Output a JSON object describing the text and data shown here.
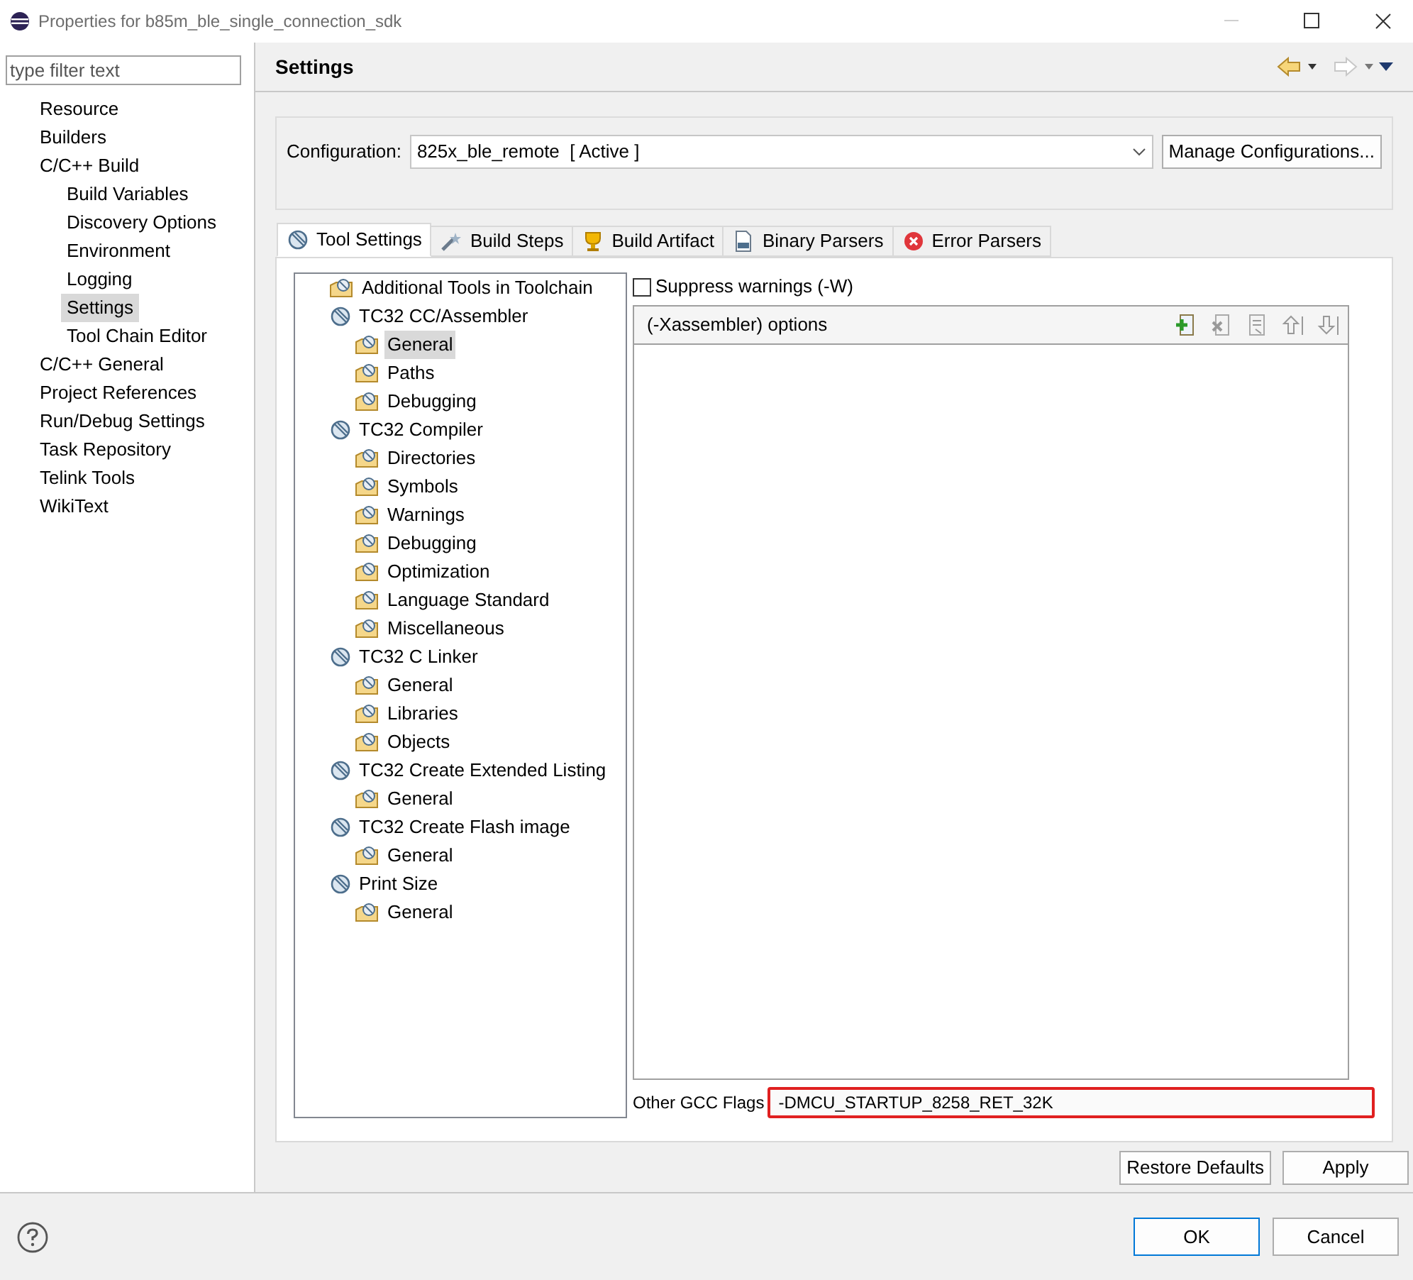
{
  "window": {
    "title": "Properties for b85m_ble_single_connection_sdk"
  },
  "filter": {
    "placeholder": "type filter text"
  },
  "sidebar": {
    "items": [
      {
        "label": "Resource",
        "selected": false
      },
      {
        "label": "Builders",
        "selected": false
      },
      {
        "label": "C/C++ Build",
        "selected": false,
        "children": [
          {
            "label": "Build Variables",
            "selected": false
          },
          {
            "label": "Discovery Options",
            "selected": false
          },
          {
            "label": "Environment",
            "selected": false
          },
          {
            "label": "Logging",
            "selected": false
          },
          {
            "label": "Settings",
            "selected": true
          },
          {
            "label": "Tool Chain Editor",
            "selected": false
          }
        ]
      },
      {
        "label": "C/C++ General",
        "selected": false
      },
      {
        "label": "Project References",
        "selected": false
      },
      {
        "label": "Run/Debug Settings",
        "selected": false
      },
      {
        "label": "Task Repository",
        "selected": false
      },
      {
        "label": "Telink Tools",
        "selected": false
      },
      {
        "label": "WikiText",
        "selected": false
      }
    ]
  },
  "page_title": "Settings",
  "configuration": {
    "label": "Configuration:",
    "value": "825x_ble_remote  [ Active ]",
    "button": "Manage Configurations..."
  },
  "tabs": [
    {
      "label": "Tool Settings",
      "selected": true,
      "kind": "tool"
    },
    {
      "label": "Build Steps",
      "selected": false,
      "kind": "steps"
    },
    {
      "label": "Build Artifact",
      "selected": false,
      "kind": "artifact"
    },
    {
      "label": "Binary Parsers",
      "selected": false,
      "kind": "binary"
    },
    {
      "label": "Error Parsers",
      "selected": false,
      "kind": "error"
    }
  ],
  "tool_tree": [
    {
      "label": "Additional Tools in Toolchain",
      "kind": "category",
      "selected": false
    },
    {
      "label": "TC32 CC/Assembler",
      "kind": "tool",
      "selected": false,
      "children": [
        {
          "label": "General",
          "kind": "category",
          "selected": true
        },
        {
          "label": "Paths",
          "kind": "category",
          "selected": false
        },
        {
          "label": "Debugging",
          "kind": "category",
          "selected": false
        }
      ]
    },
    {
      "label": "TC32 Compiler",
      "kind": "tool",
      "selected": false,
      "children": [
        {
          "label": "Directories",
          "kind": "category",
          "selected": false
        },
        {
          "label": "Symbols",
          "kind": "category",
          "selected": false
        },
        {
          "label": "Warnings",
          "kind": "category",
          "selected": false
        },
        {
          "label": "Debugging",
          "kind": "category",
          "selected": false
        },
        {
          "label": "Optimization",
          "kind": "category",
          "selected": false
        },
        {
          "label": "Language Standard",
          "kind": "category",
          "selected": false
        },
        {
          "label": "Miscellaneous",
          "kind": "category",
          "selected": false
        }
      ]
    },
    {
      "label": "TC32 C Linker",
      "kind": "tool",
      "selected": false,
      "children": [
        {
          "label": "General",
          "kind": "category",
          "selected": false
        },
        {
          "label": "Libraries",
          "kind": "category",
          "selected": false
        },
        {
          "label": "Objects",
          "kind": "category",
          "selected": false
        }
      ]
    },
    {
      "label": "TC32 Create Extended Listing",
      "kind": "tool",
      "selected": false,
      "children": [
        {
          "label": "General",
          "kind": "category",
          "selected": false
        }
      ]
    },
    {
      "label": "TC32 Create Flash image",
      "kind": "tool",
      "selected": false,
      "children": [
        {
          "label": "General",
          "kind": "category",
          "selected": false
        }
      ]
    },
    {
      "label": "Print Size",
      "kind": "tool",
      "selected": false,
      "children": [
        {
          "label": "General",
          "kind": "category",
          "selected": false
        }
      ]
    }
  ],
  "suppress_warnings": {
    "label": "Suppress warnings (-W)",
    "checked": false
  },
  "options_list": {
    "title": "(-Xassembler) options"
  },
  "other_flags": {
    "label": "Other GCC Flags",
    "value": "-DMCU_STARTUP_8258_RET_32K",
    "highlighted": true
  },
  "buttons": {
    "restore": "Restore Defaults",
    "apply": "Apply",
    "ok": "OK",
    "cancel": "Cancel"
  }
}
